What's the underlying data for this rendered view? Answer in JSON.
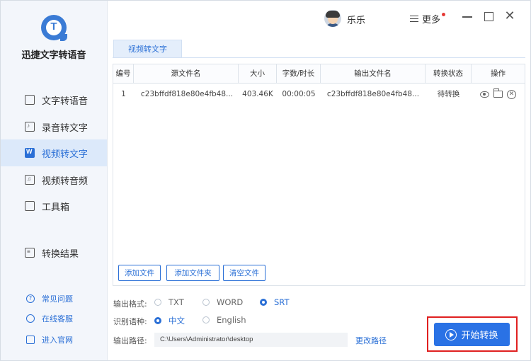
{
  "app": {
    "name": "迅捷文字转语音"
  },
  "sidebar": {
    "items": [
      {
        "label": "文字转语音",
        "icon": "text-to-speech-icon"
      },
      {
        "label": "录音转文字",
        "icon": "recording-to-text-icon"
      },
      {
        "label": "视频转文字",
        "icon": "video-to-text-icon",
        "active": true
      },
      {
        "label": "视频转音频",
        "icon": "video-to-audio-icon"
      },
      {
        "label": "工具箱",
        "icon": "toolbox-icon"
      },
      {
        "label": "转换结果",
        "icon": "results-icon"
      }
    ],
    "help": [
      {
        "label": "常见问题",
        "icon": "question-icon"
      },
      {
        "label": "在线客服",
        "icon": "headset-icon"
      },
      {
        "label": "进入官网",
        "icon": "monitor-icon"
      }
    ]
  },
  "titlebar": {
    "username": "乐乐",
    "more_label": "更多"
  },
  "tab": {
    "label": "视频转文字"
  },
  "table": {
    "headers": [
      "编号",
      "源文件名",
      "大小",
      "字数/时长",
      "输出文件名",
      "转换状态",
      "操作"
    ],
    "rows": [
      {
        "index": "1",
        "source": "c23bffdf818e80e4fb48...",
        "size": "403.46K",
        "duration": "00:00:05",
        "output": "c23bffdf818e80e4fb48...",
        "status": "待转换"
      }
    ]
  },
  "buttons": {
    "add_file": "添加文件",
    "add_folder": "添加文件夹",
    "clear_files": "清空文件",
    "start": "开始转换"
  },
  "options": {
    "format_label": "输出格式:",
    "formats": [
      "TXT",
      "WORD",
      "SRT"
    ],
    "selected_format": "SRT",
    "language_label": "识别语种:",
    "languages": [
      "中文",
      "English"
    ],
    "selected_language": "中文",
    "path_label": "输出路径:",
    "path_value": "C:\\Users\\Administrator\\desktop",
    "change_path": "更改路径"
  },
  "colors": {
    "accent": "#2a6fd6",
    "highlight_frame": "#e02020",
    "sidebar_bg": "#f3f6fb"
  }
}
